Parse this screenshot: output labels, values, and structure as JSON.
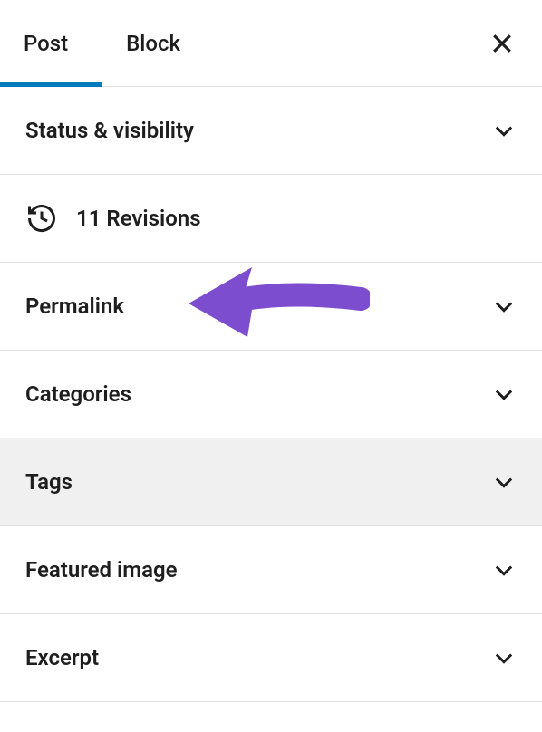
{
  "tabs": {
    "post": "Post",
    "block": "Block"
  },
  "panels": {
    "status": "Status & visibility",
    "revisions": "11 Revisions",
    "permalink": "Permalink",
    "categories": "Categories",
    "tags": "Tags",
    "featured_image": "Featured image",
    "excerpt": "Excerpt"
  },
  "colors": {
    "accent": "#007cba",
    "arrow": "#7c4dce"
  }
}
